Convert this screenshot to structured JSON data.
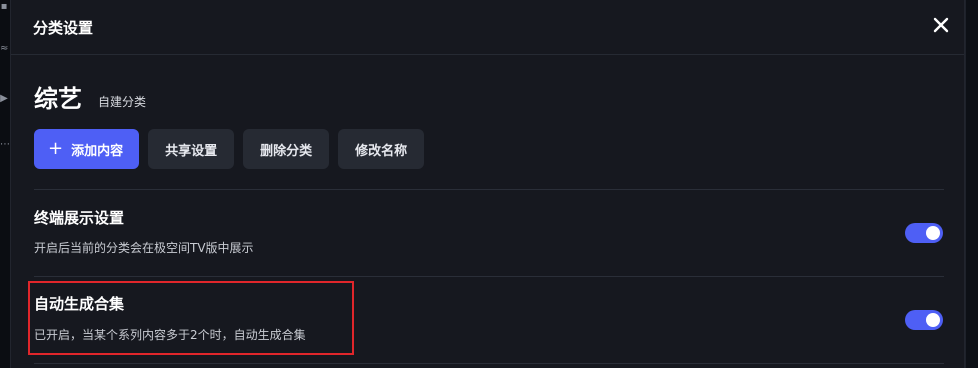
{
  "dialog": {
    "title": "分类设置",
    "close_icon": "close-icon"
  },
  "category": {
    "name": "综艺",
    "tag": "自建分类"
  },
  "actions": {
    "add_plus": "+",
    "add_label": "添加内容",
    "share_label": "共享设置",
    "delete_label": "删除分类",
    "rename_label": "修改名称"
  },
  "settings": [
    {
      "title": "终端展示设置",
      "description": "开启后当前的分类会在极空间TV版中展示",
      "enabled": true
    },
    {
      "title": "自动生成合集",
      "description": "已开启，当某个系列内容多于2个时，自动生成合集",
      "enabled": true
    }
  ],
  "colors": {
    "accent": "#4e5ff5",
    "highlight_border": "#e0262b",
    "panel_bg": "#16181f"
  }
}
